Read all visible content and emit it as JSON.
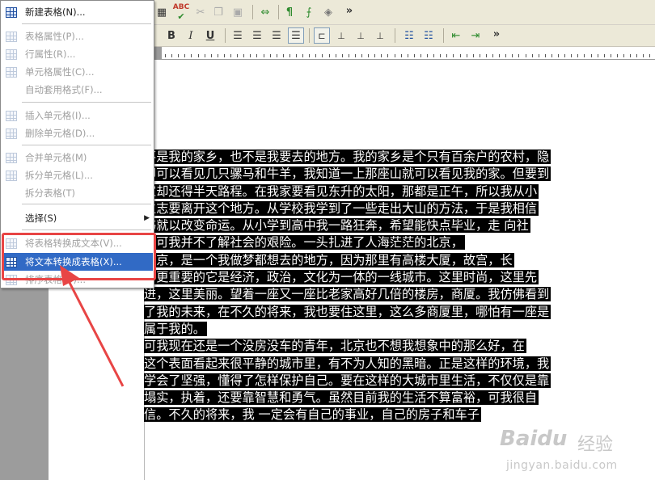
{
  "menu": {
    "items": [
      {
        "label": "新建表格(N)...",
        "icon": "new-table-icon",
        "enabled": true
      },
      {
        "label": "表格属性(P)...",
        "icon": "table-properties-icon",
        "enabled": false
      },
      {
        "label": "行属性(R)...",
        "icon": "row-properties-icon",
        "enabled": false
      },
      {
        "label": "单元格属性(C)...",
        "icon": "cell-properties-icon",
        "enabled": false
      },
      {
        "label": "自动套用格式(F)...",
        "icon": "",
        "enabled": false
      },
      {
        "label": "插入单元格(I)...",
        "icon": "insert-cell-icon",
        "enabled": false
      },
      {
        "label": "删除单元格(D)...",
        "icon": "delete-cell-icon",
        "enabled": false
      },
      {
        "label": "合并单元格(M)",
        "icon": "merge-cells-icon",
        "enabled": false
      },
      {
        "label": "拆分单元格(L)...",
        "icon": "split-cell-icon",
        "enabled": false
      },
      {
        "label": "拆分表格(T)",
        "icon": "",
        "enabled": false
      },
      {
        "label": "选择(S)",
        "icon": "",
        "enabled": true,
        "submenu": true
      },
      {
        "label": "将表格转换成文本(V)...",
        "icon": "table-to-text-icon",
        "enabled": false
      },
      {
        "label": "将文本转换成表格(X)...",
        "icon": "text-to-table-icon",
        "enabled": true,
        "highlighted": true
      },
      {
        "label": "排序表格(O)...",
        "icon": "sort-table-icon",
        "enabled": false
      }
    ]
  },
  "toolbar": {
    "spell_label": "ABC",
    "pilcrow": "¶",
    "overflow": "»",
    "bold": "B",
    "italic": "I",
    "underline": "U"
  },
  "document": {
    "lines": [
      "不是我的家乡，也不是我要去的地方。我的家乡是个只有百余户的农村，隐",
      "却可以看见几只骡马和牛羊，我知道一上那座山就可以看见我的家。但要到",
      "家却还得半天路程。在我家要看见东升的太阳，那都是正午，所以我从小",
      "立志要离开这个地方。从学校我学到了一些走出大山的方法，于是我相信",
      "书就以改变命运。从小学到高中我一路狂奔，希望能快点毕业，走  向社",
      "。可我并不了解社会的艰险。一头扎进了人海茫茫的北京，",
      "    北京，是一个我做梦都想去的地方，因为那里有高楼大厦，故宫，长",
      "。更重要的它是经济，政治，文化为一体的一线城市。这里时尚，这里先",
      "进，这里美丽。望着一座又一座比老家高好几倍的楼房，商厦。我仿佛看到",
      "了我的未来，在不久的将来，我也要住这里，这么多商厦里，哪怕有一座是",
      "属于我的。",
      "    可我现在还是一个没房没车的青年，北京也不想我想象中的那么好，在",
      "这个表面看起来很平静的城市里，有不为人知的黑暗。正是这样的环境，我",
      "学会了坚强，懂得了怎样保护自己。要在这样的大城市里生活，不仅仅是靠",
      "塌实，执着，还要靠智慧和勇气。虽然目前我的生活不算富裕，可我很自",
      "信。不久的将来，我 一定会有自己的事业，自己的房子和车子"
    ]
  },
  "watermark": {
    "brand": "Baidu",
    "brand_cn": "经验",
    "url": "jingyan.baidu.com"
  },
  "colors": {
    "highlight": "#316ac5",
    "annotation": "#e84545"
  }
}
